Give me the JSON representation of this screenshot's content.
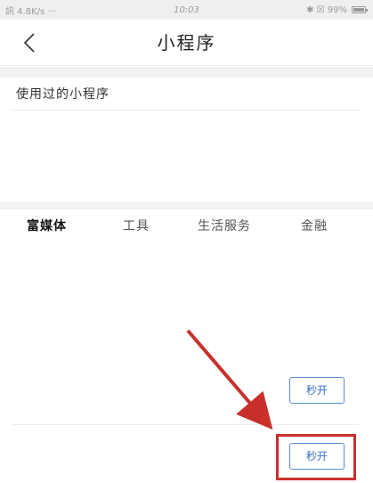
{
  "status_bar": {
    "signal": "訊 4.8K/s ···",
    "time": "10:03",
    "battery_text": "✱ ☒ 99%"
  },
  "nav": {
    "title": "小程序"
  },
  "recent": {
    "heading": "使用过的小程序"
  },
  "tabs": [
    {
      "label": "富媒体",
      "active": true
    },
    {
      "label": "工具",
      "active": false
    },
    {
      "label": "生活服务",
      "active": false
    },
    {
      "label": "金融",
      "active": false
    }
  ],
  "list_items": [
    {
      "button_label": "秒开"
    },
    {
      "button_label": "秒开"
    }
  ],
  "annotation": {
    "color": "#c9302c"
  }
}
